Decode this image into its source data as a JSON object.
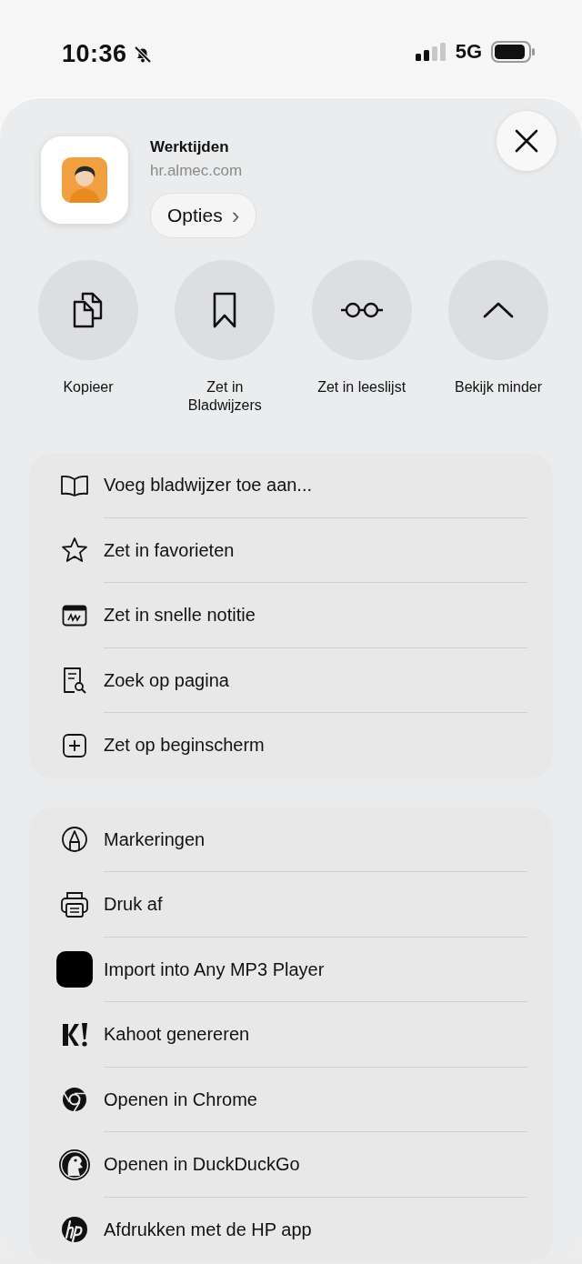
{
  "status_bar": {
    "time": "10:36",
    "network": "5G"
  },
  "header": {
    "title": "Werktijden",
    "subtitle": "hr.almec.com",
    "options_button": "Opties",
    "options_chevron": "›"
  },
  "actions": [
    {
      "label": "Kopieer"
    },
    {
      "label": "Zet in Bladwijzers"
    },
    {
      "label": "Zet in leeslijst"
    },
    {
      "label": "Bekijk minder"
    }
  ],
  "menu_groups": [
    {
      "items": [
        {
          "label": "Voeg bladwijzer toe aan..."
        },
        {
          "label": "Zet in favorieten"
        },
        {
          "label": "Zet in snelle notitie"
        },
        {
          "label": "Zoek op pagina"
        },
        {
          "label": "Zet op beginscherm"
        }
      ]
    },
    {
      "items": [
        {
          "label": "Markeringen"
        },
        {
          "label": "Druk af"
        },
        {
          "label": "Import into Any MP3 Player"
        },
        {
          "label": "Kahoot genereren"
        },
        {
          "label": "Openen in Chrome"
        },
        {
          "label": "Openen in DuckDuckGo"
        },
        {
          "label": "Afdrukken met de HP app"
        }
      ]
    }
  ]
}
